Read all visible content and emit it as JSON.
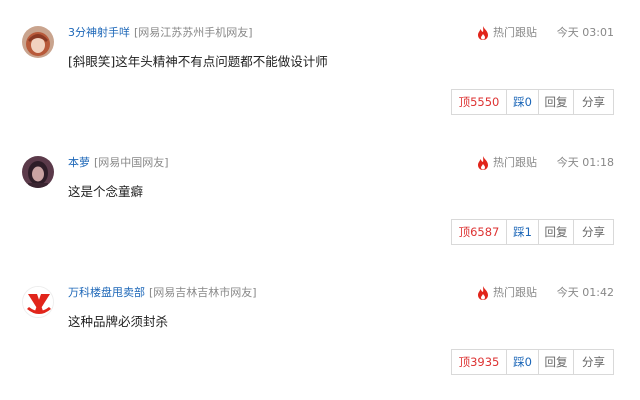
{
  "comments": [
    {
      "username": "3分神射手咩",
      "location": "[网易江苏苏州手机网友]",
      "hot_label": "热门跟贴",
      "time": "今天 03:01",
      "text": "[斜眼笑]这年头精神不有点问题都不能做设计师",
      "up_label": "顶5550",
      "down_label": "踩0",
      "reply_label": "回复",
      "share_label": "分享",
      "avatar_colors": {
        "bg": "#c9a48e",
        "hair": "#b85a3a",
        "face": "#f2d2bf"
      }
    },
    {
      "username": "本萝",
      "location": "[网易中国网友]",
      "hot_label": "热门跟贴",
      "time": "今天 01:18",
      "text": "这是个念童癖",
      "up_label": "顶6587",
      "down_label": "踩1",
      "reply_label": "回复",
      "share_label": "分享",
      "avatar_colors": {
        "bg": "#5b3a4a",
        "hair": "#2e1d28",
        "face": "#caa3a3"
      }
    },
    {
      "username": "万科楼盘甩卖部",
      "location": "[网易吉林吉林市网友]",
      "hot_label": "热门跟贴",
      "time": "今天 01:42",
      "text": "这种品牌必须封杀",
      "up_label": "顶3935",
      "down_label": "踩0",
      "reply_label": "回复",
      "share_label": "分享",
      "avatar_colors": {
        "bg": "#ffffff",
        "hair": "#e1251b",
        "face": "#e1251b"
      }
    }
  ],
  "colors": {
    "username": "#1d67b8",
    "up": "#d33",
    "flame": "#e1251b"
  }
}
